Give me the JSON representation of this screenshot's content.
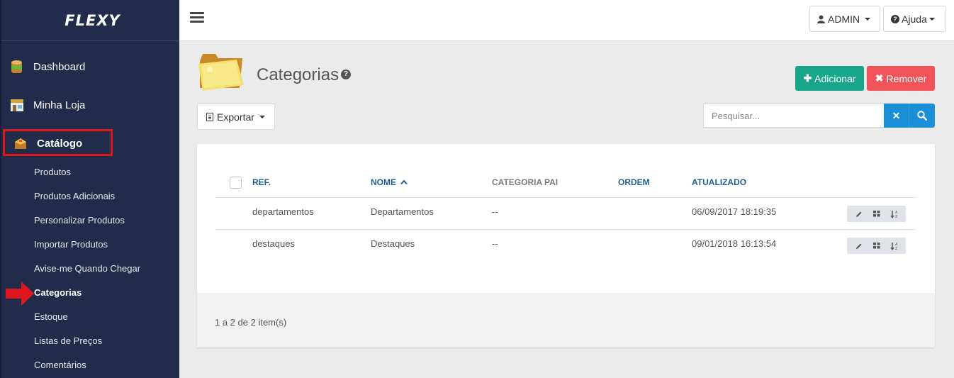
{
  "brand": {
    "logo": "FLEXY"
  },
  "sidebar": {
    "main": [
      {
        "label": "Dashboard",
        "icon": "dashboard-icon"
      },
      {
        "label": "Minha Loja",
        "icon": "store-icon"
      },
      {
        "label": "Catálogo",
        "icon": "catalog-icon"
      }
    ],
    "sub": [
      {
        "label": "Produtos"
      },
      {
        "label": "Produtos Adicionais"
      },
      {
        "label": "Personalizar Produtos"
      },
      {
        "label": "Importar Produtos"
      },
      {
        "label": "Avise-me Quando Chegar"
      },
      {
        "label": "Categorias",
        "active": true
      },
      {
        "label": "Estoque"
      },
      {
        "label": "Listas de Preços"
      },
      {
        "label": "Comentários"
      }
    ]
  },
  "topbar": {
    "user_label": "ADMIN",
    "help_label": "Ajuda"
  },
  "page": {
    "title": "Categorias",
    "add_label": "Adicionar",
    "remove_label": "Remover",
    "export_label": "Exportar",
    "search_placeholder": "Pesquisar..."
  },
  "table": {
    "columns": [
      "REF.",
      "NOME",
      "CATEGORIA PAI",
      "ORDEM",
      "ATUALIZADO"
    ],
    "rows": [
      {
        "ref": "departamentos",
        "nome": "Departamentos",
        "pai": "--",
        "ordem": "",
        "atualizado": "06/09/2017 18:19:35"
      },
      {
        "ref": "destaques",
        "nome": "Destaques",
        "pai": "--",
        "ordem": "",
        "atualizado": "09/01/2018 16:13:54"
      }
    ],
    "footer": "1 a 2 de 2 item(s)"
  },
  "colors": {
    "sidebar_bg": "#212b4a",
    "add_button": "#17a68a",
    "remove_button": "#f0545a",
    "search_button": "#1a8fd8",
    "highlight_red": "#e0161e"
  }
}
